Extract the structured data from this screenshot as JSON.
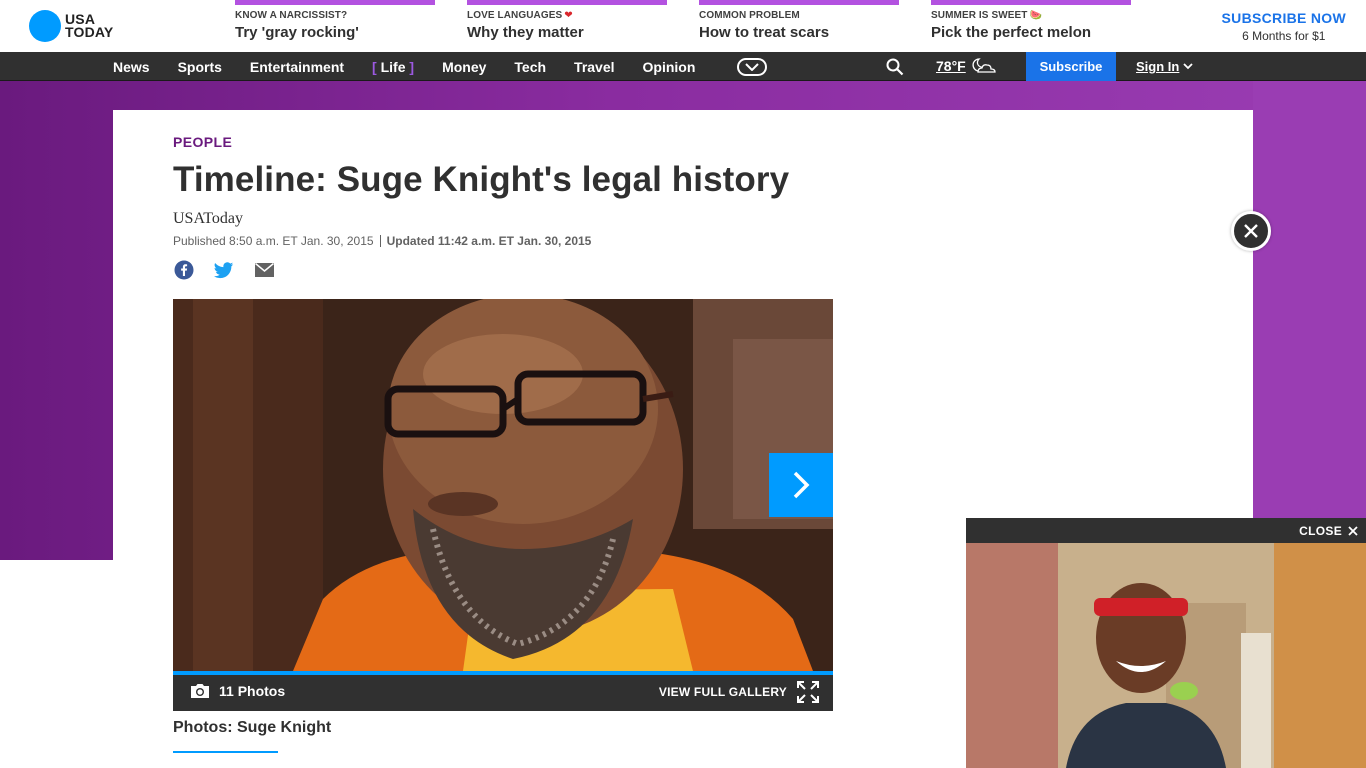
{
  "brand": {
    "logo_line1": "USA",
    "logo_line2": "TODAY"
  },
  "promos": [
    {
      "kicker": "KNOW A NARCISSIST?",
      "title": "Try 'gray rocking'",
      "emoji": ""
    },
    {
      "kicker": "LOVE LANGUAGES",
      "title": "Why they matter",
      "emoji": "❤"
    },
    {
      "kicker": "COMMON PROBLEM",
      "title": "How to treat scars",
      "emoji": ""
    },
    {
      "kicker": "SUMMER IS SWEET",
      "title": "Pick the perfect melon",
      "emoji": "🍉"
    }
  ],
  "subscribe_promo": {
    "title": "SUBSCRIBE NOW",
    "subtitle": "6 Months for $1"
  },
  "nav": {
    "items": [
      "News",
      "Sports",
      "Entertainment",
      "Life",
      "Money",
      "Tech",
      "Travel",
      "Opinion"
    ],
    "active_index": 3,
    "active_left_bracket": "[",
    "active_right_bracket": "]",
    "weather": "78°F",
    "subscribe": "Subscribe",
    "sign_in": "Sign In"
  },
  "article": {
    "section": "PEOPLE",
    "headline": "Timeline: Suge Knight's legal history",
    "byline": "USAToday",
    "published": "Published 8:50 a.m. ET Jan. 30, 2015",
    "updated_label": "Updated",
    "updated": "11:42 a.m. ET Jan. 30, 2015",
    "share_icons": [
      "facebook-icon",
      "twitter-icon",
      "email-icon"
    ]
  },
  "gallery": {
    "photo_count": "11 Photos",
    "view_full": "VIEW FULL GALLERY",
    "caption": "Photos: Suge Knight"
  },
  "video": {
    "close_label": "CLOSE"
  },
  "colors": {
    "brand_blue": "#009bff",
    "life_purple": "#6a1a7e",
    "promo_purple": "#b352e0",
    "subscribe_blue": "#1a73e8",
    "nav_dark": "#303030"
  }
}
